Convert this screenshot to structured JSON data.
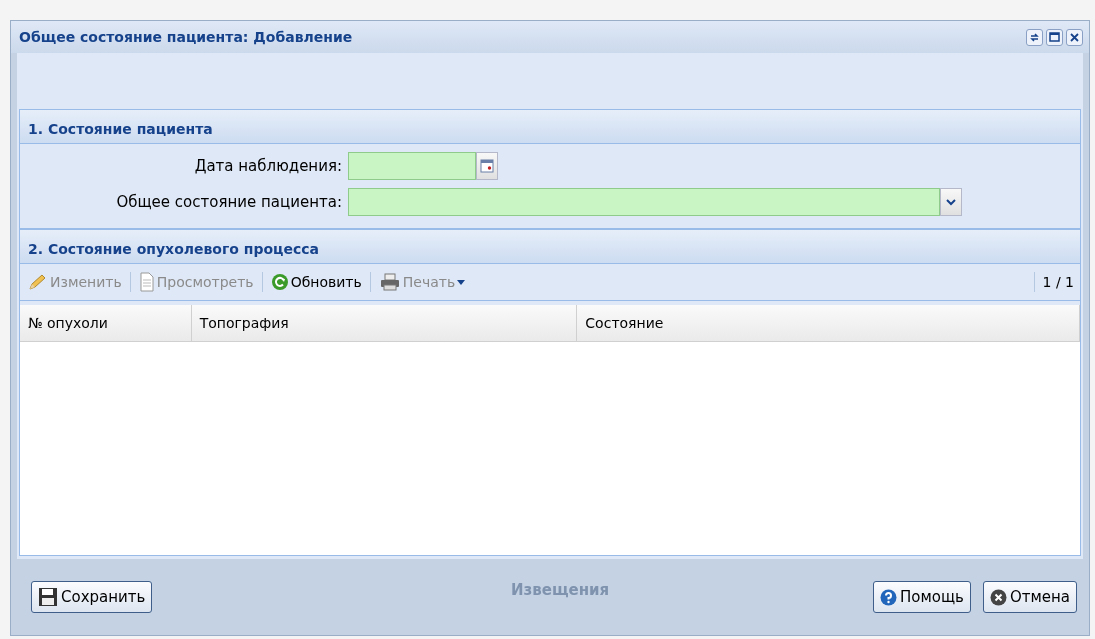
{
  "window": {
    "title": "Общее состояние пациента: Добавление"
  },
  "background_label": "Извещения",
  "section1": {
    "title": "1. Состояние пациента",
    "fields": [
      {
        "kind": "date",
        "label": "Дата наблюдения:"
      },
      {
        "kind": "combo",
        "label": "Общее состояние пациента:"
      }
    ]
  },
  "section2": {
    "title": "2. Состояние опухолевого процесса",
    "toolbar": [
      {
        "kind": "edit",
        "label": "Изменить",
        "disabled": true
      },
      {
        "kind": "view",
        "label": "Просмотреть",
        "disabled": true
      },
      {
        "kind": "refresh",
        "label": "Обновить",
        "disabled": false
      },
      {
        "kind": "print",
        "label": "Печать",
        "disabled": true
      }
    ],
    "pager": "1 / 1",
    "table": {
      "columns": [
        "№ опухоли",
        "Топография",
        "Состояние"
      ]
    }
  },
  "buttons": [
    {
      "kind": "save",
      "label": "Сохранить"
    },
    {
      "kind": "help",
      "label": "Помощь"
    },
    {
      "kind": "cancel",
      "label": "Отмена"
    }
  ]
}
